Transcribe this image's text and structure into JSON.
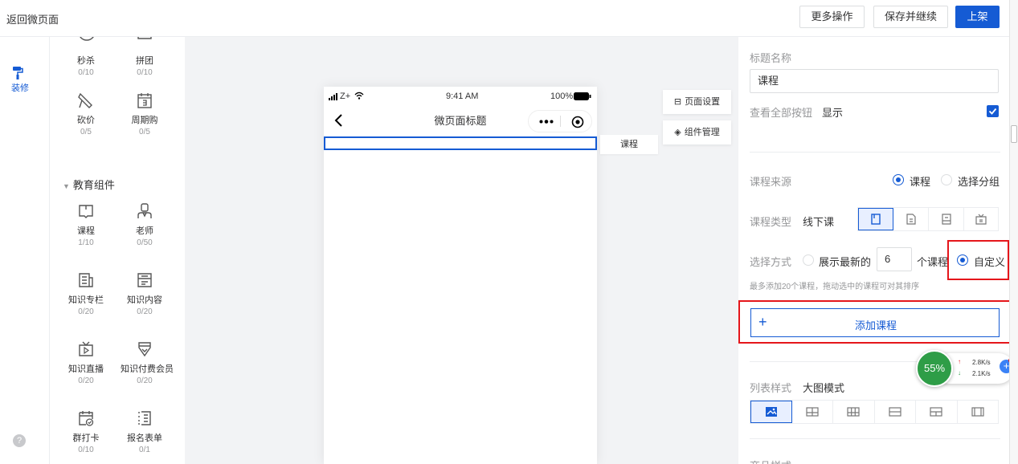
{
  "topbar": {
    "back_label": "返回微页面",
    "more_label": "更多操作",
    "save_label": "保存并继续",
    "publish_label": "上架"
  },
  "leftnav": {
    "decorate_label": "装修",
    "help_label": "?"
  },
  "palette": {
    "marketing": [
      {
        "name": "秒杀",
        "count": "0/10"
      },
      {
        "name": "拼团",
        "count": "0/10"
      },
      {
        "name": "砍价",
        "count": "0/5"
      },
      {
        "name": "周期购",
        "count": "0/5"
      }
    ],
    "education_title": "教育组件",
    "education": [
      {
        "name": "课程",
        "count": "1/10"
      },
      {
        "name": "老师",
        "count": "0/50"
      },
      {
        "name": "知识专栏",
        "count": "0/20"
      },
      {
        "name": "知识内容",
        "count": "0/20"
      },
      {
        "name": "知识直播",
        "count": "0/20"
      },
      {
        "name": "知识付费会员",
        "count": "0/20"
      },
      {
        "name": "群打卡",
        "count": "0/10"
      },
      {
        "name": "报名表单",
        "count": "0/1"
      }
    ]
  },
  "phone": {
    "carrier": "Z+",
    "time": "9:41 AM",
    "battery": "100%",
    "page_title": "微页面标题",
    "component_tag": "课程"
  },
  "canvas_buttons": {
    "page_settings": "页面设置",
    "component_manage": "组件管理"
  },
  "panel": {
    "title_label": "标题名称",
    "title_value": "课程",
    "view_all_label": "查看全部按钮",
    "view_all_value": "显示",
    "source_label": "课程来源",
    "source_options": [
      "课程",
      "选择分组"
    ],
    "type_label": "课程类型",
    "type_value": "线下课",
    "select_label": "选择方式",
    "select_latest_prefix": "展示最新的",
    "select_latest_count": "6",
    "select_latest_suffix": "个课程",
    "select_custom": "自定义",
    "hint": "最多添加20个课程，拖动选中的课程可对其排序",
    "add_button": "添加课程",
    "list_style_label": "列表样式",
    "list_style_value": "大图模式",
    "product_style_label": "商品样式"
  },
  "net_widget": {
    "percent": "55%",
    "up": "2.8K/s",
    "down": "2.1K/s"
  },
  "colors": {
    "primary": "#155bd4",
    "highlight": "#e5161b"
  }
}
